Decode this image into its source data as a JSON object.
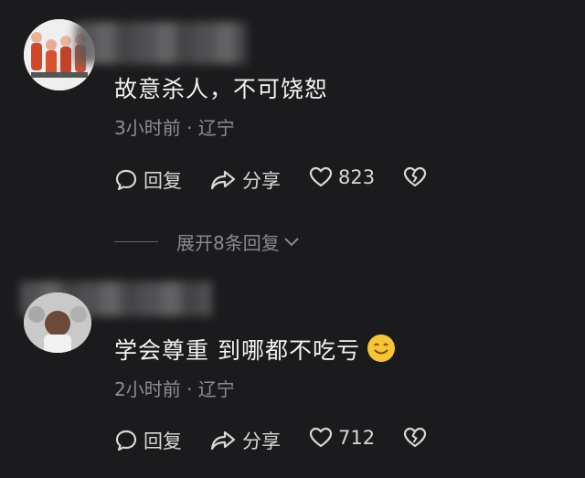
{
  "comments": [
    {
      "text": "故意杀人，不可饶恕",
      "meta": "3小时前 · 辽宁",
      "reply_label": "回复",
      "share_label": "分享",
      "likes": "823",
      "expand_label": "展开8条回复"
    },
    {
      "text": "学会尊重 到哪都不吃亏",
      "meta": "2小时前 · 辽宁",
      "reply_label": "回复",
      "share_label": "分享",
      "likes": "712"
    }
  ],
  "colors": {
    "background": "#1b1b1d",
    "text": "#f2f2f2",
    "meta": "#8e8e90",
    "emoji": "#f7c533"
  },
  "icons": [
    "comment-icon",
    "share-icon",
    "heart-icon",
    "broken-heart-icon",
    "chevron-down-icon",
    "smile-emoji"
  ]
}
